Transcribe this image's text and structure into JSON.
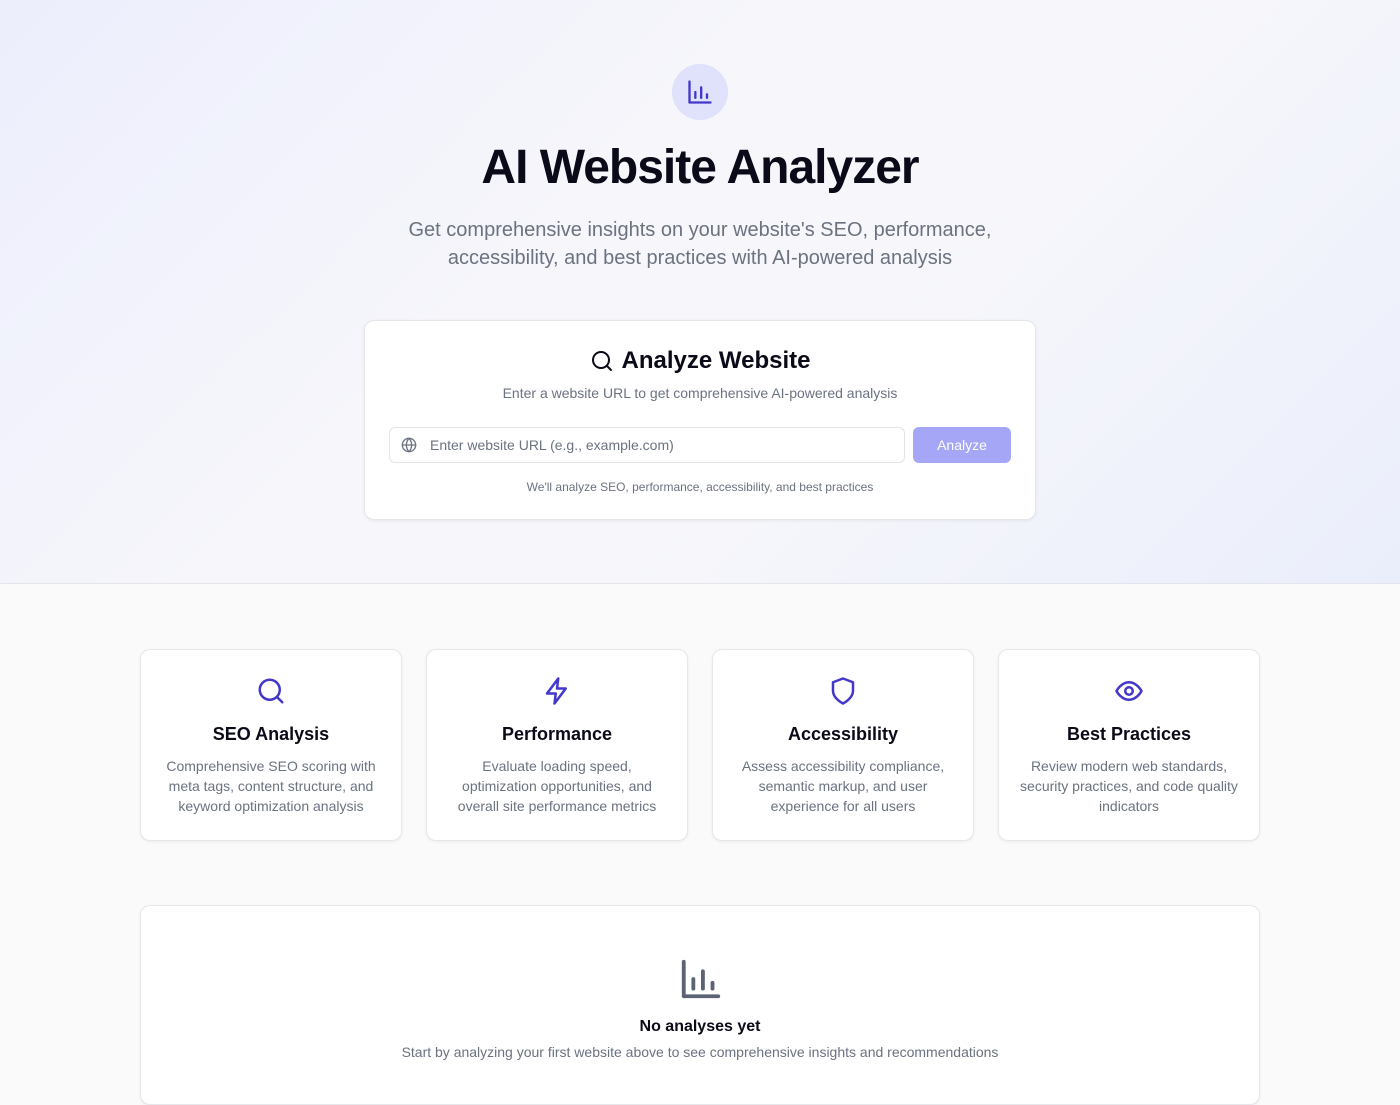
{
  "hero": {
    "title": "AI Website Analyzer",
    "subtitle": "Get comprehensive insights on your website's SEO, performance, accessibility, and best practices with AI-powered analysis",
    "badge_icon": "bar-chart-icon"
  },
  "analyze": {
    "title": "Analyze Website",
    "title_icon": "search-icon",
    "description": "Enter a website URL to get comprehensive AI-powered analysis",
    "input_value": "",
    "input_placeholder": "Enter website URL (e.g., example.com)",
    "input_icon": "globe-icon",
    "button_label": "Analyze",
    "note": "We'll analyze SEO, performance, accessibility, and best practices"
  },
  "features": [
    {
      "icon": "search-icon",
      "title": "SEO Analysis",
      "description": "Comprehensive SEO scoring with meta tags, content structure, and keyword optimization analysis"
    },
    {
      "icon": "lightning-icon",
      "title": "Performance",
      "description": "Evaluate loading speed, optimization opportunities, and overall site performance metrics"
    },
    {
      "icon": "shield-icon",
      "title": "Accessibility",
      "description": "Assess accessibility compliance, semantic markup, and user experience for all users"
    },
    {
      "icon": "eye-icon",
      "title": "Best Practices",
      "description": "Review modern web standards, security practices, and code quality indicators"
    }
  ],
  "empty_state": {
    "icon": "bar-chart-icon",
    "title": "No analyses yet",
    "description": "Start by analyzing your first website above to see comprehensive insights and recommendations"
  },
  "colors": {
    "accent": "#4338ca",
    "button": "#a5a6f6",
    "badge_bg": "#e0e1fa",
    "muted_text": "#6b7280"
  }
}
